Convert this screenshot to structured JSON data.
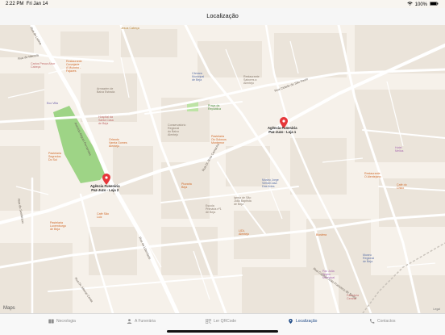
{
  "status_bar": {
    "time": "2:22 PM",
    "date": "Fri Jan 14",
    "battery": "100%"
  },
  "nav": {
    "title": "Localização"
  },
  "map": {
    "attribution": "Maps",
    "legal": "Legal",
    "pins": [
      {
        "label_line1": "Agência Funerária",
        "label_line2": "Paz-Juzo - Loja 1"
      },
      {
        "label_line1": "Agência Funerária",
        "label_line2": "Paz-Juzo - Loja 2"
      }
    ],
    "places": [
      {
        "name": "Jesus Cabeça"
      },
      {
        "name": "Carlos Pesca Alvor\nCabeça"
      },
      {
        "name": "Restaurante\nCervejaria\nA Murinho -\nFajazes"
      },
      {
        "name": "Armazém de\nBaixa Estrada"
      },
      {
        "name": "Eco Villa"
      },
      {
        "name": "Câmara\nMunicipal\nde Beja"
      },
      {
        "name": "Restaurante\nSabores a\nAlentejo"
      },
      {
        "name": "Praça da\nRepública"
      },
      {
        "name": "Conservatório\nRegional\ndo Baixo\nAlentejo"
      },
      {
        "name": "Pastelaria\nOs Gulosos\nMontemor"
      },
      {
        "name": "Hospital da\nSanta Casa\nde Beja"
      },
      {
        "name": "Orlando\nVarela Gomes\nAlentejo"
      },
      {
        "name": "Museu Jorge\nVieira/Casa\nDas Artes"
      },
      {
        "name": "Igreja de São\nJoão Baptista\nde Beja"
      },
      {
        "name": "Pastelaria\nSegredos\nDo Sul"
      },
      {
        "name": "Café São\nLuiz"
      },
      {
        "name": "Pastelaria\nLuxemburgo\nde Beja"
      },
      {
        "name": "Pizzaria\nBeja"
      },
      {
        "name": "Escola\nPrimária nº1\nde Beja"
      },
      {
        "name": "LIDL\nAlentejo"
      },
      {
        "name": "Biosfera"
      },
      {
        "name": "Museu\nRegional\nde Beja"
      },
      {
        "name": "Pax Julia\nTeatro\nMunicipal"
      },
      {
        "name": "Farmácia\nCentral"
      },
      {
        "name": "Restaurante\nO Alentejano"
      },
      {
        "name": "Café do\nChico"
      },
      {
        "name": "Hotel\nMelius"
      }
    ],
    "streets": [
      {
        "name": "Avenida Miguel Fernandes"
      },
      {
        "name": "Rua de Mértola"
      },
      {
        "name": "Rua da Liberdade"
      },
      {
        "name": "Rua do Sembrano"
      },
      {
        "name": "Rua de Lisboa"
      },
      {
        "name": "Rua Dr. Afonso Costa"
      },
      {
        "name": "Rua Cidade de São Paulo"
      },
      {
        "name": "Rua Capitão João Francisco de Sousa"
      },
      {
        "name": "Rua Dr. Brito Camacho"
      }
    ]
  },
  "tabs": [
    {
      "label": "Necrologia",
      "icon": "book-icon"
    },
    {
      "label": "A Funerária",
      "icon": "person-icon"
    },
    {
      "label": "Ler QRCode",
      "icon": "qrcode-icon"
    },
    {
      "label": "Localização",
      "icon": "location-icon"
    },
    {
      "label": "Contactos",
      "icon": "phone-icon"
    }
  ],
  "colors": {
    "accent": "#1f4a86",
    "pin": "#e6373a",
    "park": "#9ed486",
    "road": "#ffffff",
    "block": "#ece6dd"
  }
}
